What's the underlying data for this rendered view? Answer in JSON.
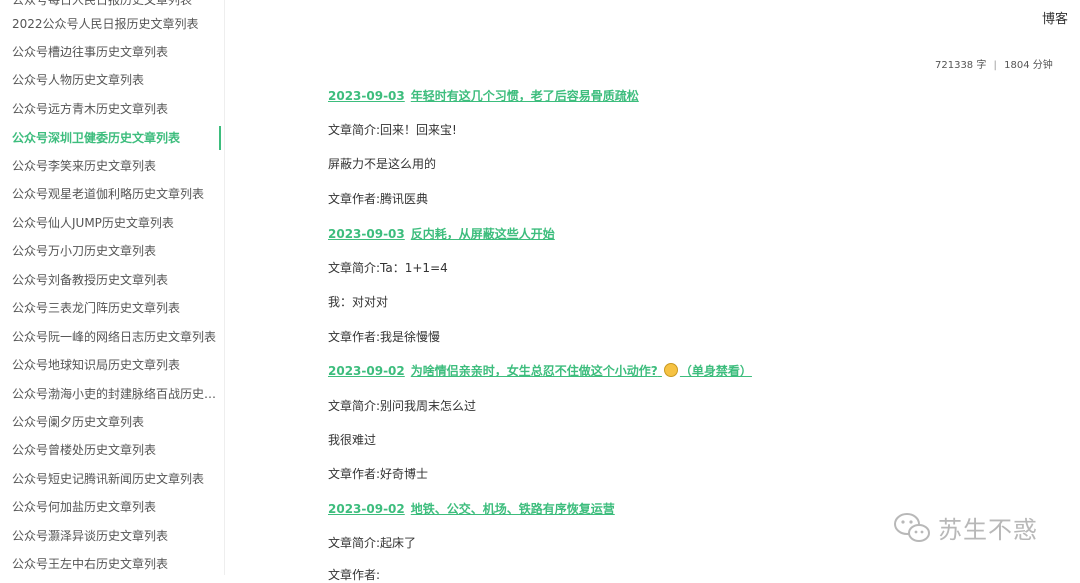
{
  "sidebar": {
    "cut_item": "公众号每日人民日报历史文章列表",
    "items": [
      {
        "label": "2022公众号人民日报历史文章列表",
        "active": false
      },
      {
        "label": "公众号槽边往事历史文章列表",
        "active": false
      },
      {
        "label": "公众号人物历史文章列表",
        "active": false
      },
      {
        "label": "公众号远方青木历史文章列表",
        "active": false
      },
      {
        "label": "公众号深圳卫健委历史文章列表",
        "active": true
      },
      {
        "label": "公众号李笑来历史文章列表",
        "active": false
      },
      {
        "label": "公众号观星老道伽利略历史文章列表",
        "active": false
      },
      {
        "label": "公众号仙人JUMP历史文章列表",
        "active": false
      },
      {
        "label": "公众号万小刀历史文章列表",
        "active": false
      },
      {
        "label": "公众号刘备教授历史文章列表",
        "active": false
      },
      {
        "label": "公众号三表龙门阵历史文章列表",
        "active": false
      },
      {
        "label": "公众号阮一峰的网络日志历史文章列表",
        "active": false
      },
      {
        "label": "公众号地球知识局历史文章列表",
        "active": false
      },
      {
        "label": "公众号渤海小吏的封建脉络百战历史文章列表",
        "active": false
      },
      {
        "label": "公众号阑夕历史文章列表",
        "active": false
      },
      {
        "label": "公众号曾楼处历史文章列表",
        "active": false
      },
      {
        "label": "公众号短史记腾讯新闻历史文章列表",
        "active": false
      },
      {
        "label": "公众号何加盐历史文章列表",
        "active": false
      },
      {
        "label": "公众号灏泽异谈历史文章列表",
        "active": false
      },
      {
        "label": "公众号王左中右历史文章列表",
        "active": false
      }
    ]
  },
  "header": {
    "blog_link": "博客"
  },
  "meta": {
    "words": "721338 字",
    "separator": "|",
    "minutes": "1804 分钟"
  },
  "articles": [
    {
      "date": "2023-09-03",
      "title": "年轻时有这几个习惯，老了后容易骨质疏松",
      "paragraphs": [
        "文章简介:回来！回来宝!",
        "屏蔽力不是这么用的",
        "文章作者:腾讯医典"
      ]
    },
    {
      "date": "2023-09-03",
      "title": "反内耗，从屏蔽这些人开始",
      "paragraphs": [
        "文章简介:Ta：1+1=4",
        "我：对对对",
        "文章作者:我是徐慢慢"
      ]
    },
    {
      "date": "2023-09-02",
      "title": "为啥情侣亲亲时，女生总忍不住做这个小动作?",
      "title_suffix": "（单身禁看）",
      "has_emoji": true,
      "paragraphs": [
        "文章简介:别问我周末怎么过",
        "我很难过",
        "文章作者:好奇博士"
      ]
    },
    {
      "date": "2023-09-02",
      "title": "地铁、公交、机场、铁路有序恢复运营",
      "paragraphs": [
        "文章简介:起床了",
        "文章作者:"
      ]
    }
  ],
  "watermark": {
    "text": "苏生不惑",
    "icon": "wechat-icon"
  },
  "colors": {
    "accent": "#3dbd7d"
  }
}
